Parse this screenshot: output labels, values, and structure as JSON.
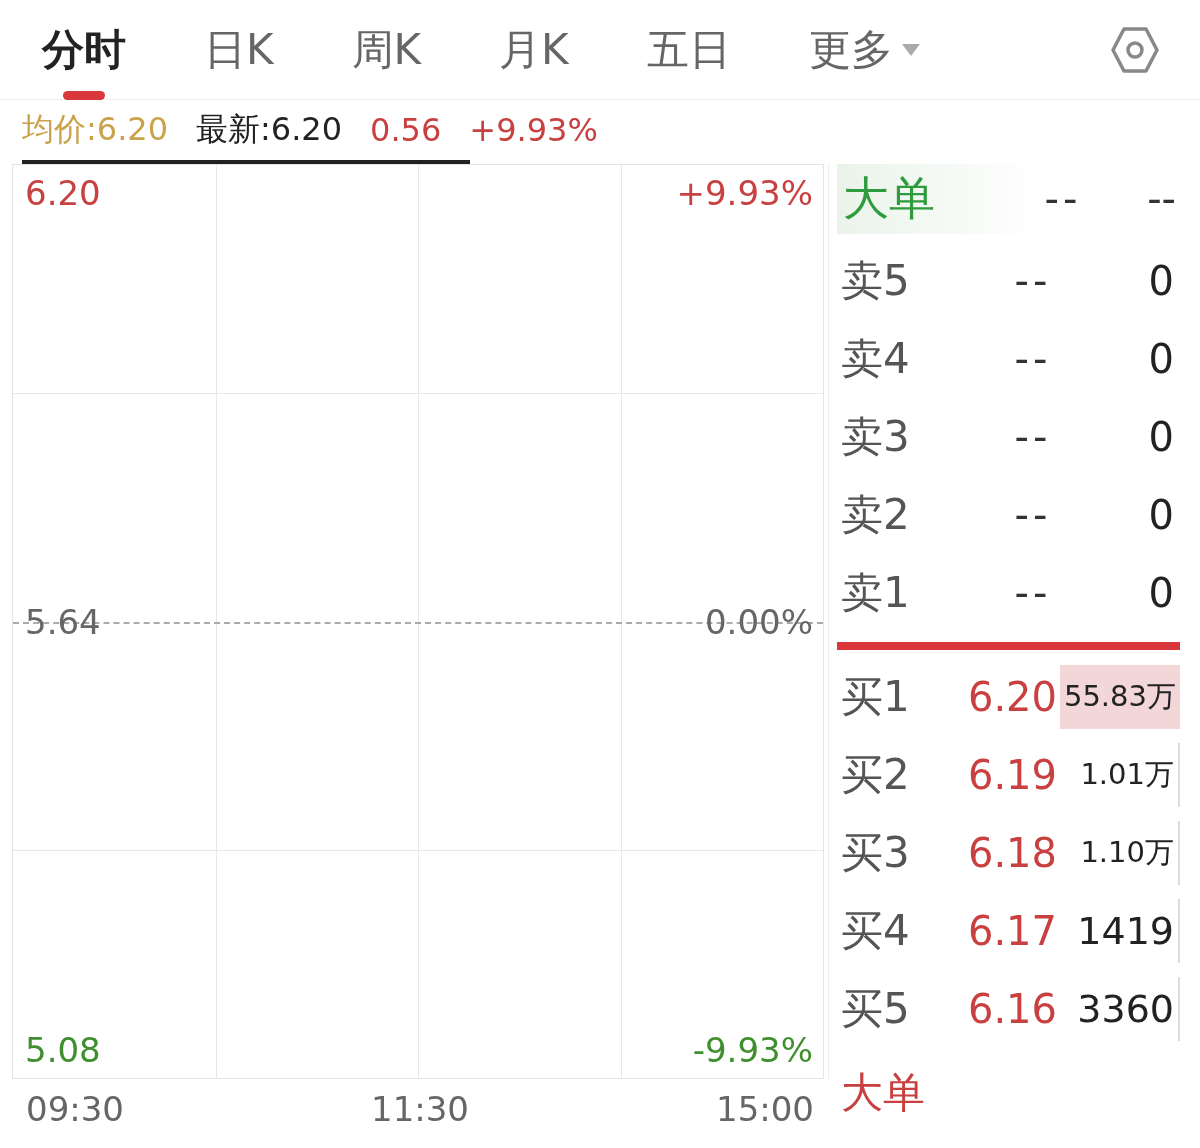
{
  "tabs": [
    {
      "label": "分时",
      "selected": true
    },
    {
      "label": "日K",
      "selected": false
    },
    {
      "label": "周K",
      "selected": false
    },
    {
      "label": "月K",
      "selected": false
    },
    {
      "label": "五日",
      "selected": false
    },
    {
      "label": "更多",
      "selected": false,
      "kind": "dropdown"
    }
  ],
  "summary": {
    "avg_price": "均价:6.20",
    "latest": "最新:6.20",
    "change": "0.56",
    "change_pct": "+9.93%"
  },
  "chart": {
    "price_labels": [
      "6.20",
      "5.64",
      "5.08"
    ],
    "pct_labels": [
      "+9.93%",
      "0.00%",
      "-9.93%"
    ],
    "time_labels": [
      "09:30",
      "11:30",
      "15:00"
    ]
  },
  "order_book": {
    "big_order": {
      "label": "大单",
      "price": "--",
      "volume": "--"
    },
    "asks": [
      {
        "label": "卖5",
        "price": "--",
        "volume": "0"
      },
      {
        "label": "卖4",
        "price": "--",
        "volume": "0"
      },
      {
        "label": "卖3",
        "price": "--",
        "volume": "0"
      },
      {
        "label": "卖2",
        "price": "--",
        "volume": "0"
      },
      {
        "label": "卖1",
        "price": "--",
        "volume": "0"
      }
    ],
    "bids": [
      {
        "label": "买1",
        "price": "6.20",
        "volume": "55.83万"
      },
      {
        "label": "买2",
        "price": "6.19",
        "volume": "1.01万"
      },
      {
        "label": "买3",
        "price": "6.18",
        "volume": "1.10万"
      },
      {
        "label": "买4",
        "price": "6.17",
        "volume": "1419"
      },
      {
        "label": "买5",
        "price": "6.16",
        "volume": "3360"
      }
    ],
    "bottom_big_order": {
      "label": "大单"
    }
  }
}
